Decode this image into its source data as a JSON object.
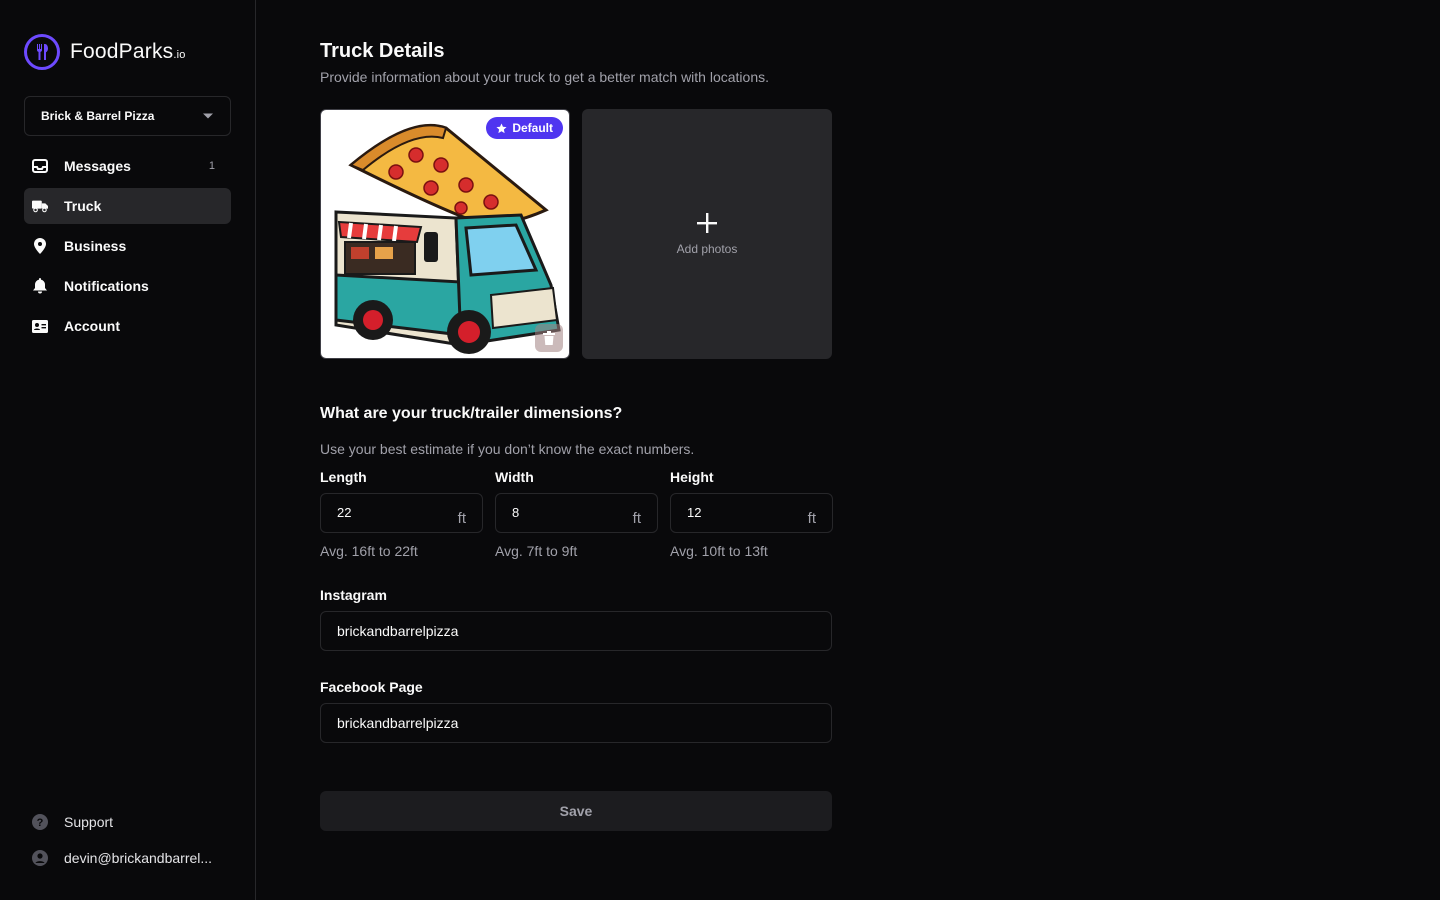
{
  "app": {
    "logo_name": "FoodParks",
    "logo_suffix": ".io"
  },
  "sidebar": {
    "business_picker": "Brick & Barrel Pizza",
    "items": [
      {
        "label": "Messages",
        "icon": "inbox-icon",
        "badge": "1"
      },
      {
        "label": "Truck",
        "icon": "truck-icon",
        "active": true
      },
      {
        "label": "Business",
        "icon": "location-pin-icon"
      },
      {
        "label": "Notifications",
        "icon": "bell-icon"
      },
      {
        "label": "Account",
        "icon": "id-card-icon"
      }
    ],
    "bottom": {
      "support_label": "Support",
      "user_email": "devin@brickandbarrel..."
    }
  },
  "main": {
    "title": "Truck Details",
    "subtitle": "Provide information about your truck to get a better match with locations.",
    "photos": {
      "default_badge": "Default",
      "add_label": "Add photos"
    },
    "dimensions": {
      "title": "What are your truck/trailer dimensions?",
      "subtitle": "Use your best estimate if you don’t know the exact numbers.",
      "fields": [
        {
          "label": "Length",
          "value": "22",
          "unit": "ft",
          "hint": "Avg. 16ft to 22ft"
        },
        {
          "label": "Width",
          "value": "8",
          "unit": "ft",
          "hint": "Avg. 7ft to 9ft"
        },
        {
          "label": "Height",
          "value": "12",
          "unit": "ft",
          "hint": "Avg. 10ft to 13ft"
        }
      ]
    },
    "instagram": {
      "label": "Instagram",
      "value": "brickandbarrelpizza"
    },
    "facebook": {
      "label": "Facebook Page",
      "value": "brickandbarrelpizza"
    },
    "save_label": "Save"
  },
  "colors": {
    "background": "#09090b",
    "accent": "#4f35f0",
    "border": "#27272a",
    "muted_text": "#a1a1aa"
  }
}
